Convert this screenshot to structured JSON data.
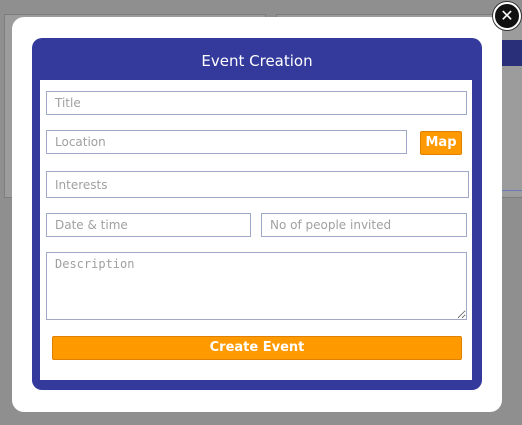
{
  "modal": {
    "close_icon": "close-icon",
    "close_glyph": "✕"
  },
  "event_form": {
    "title": "Event Creation",
    "fields": {
      "title_placeholder": "Title",
      "location_placeholder": "Location",
      "interests_placeholder": "Interests",
      "date_placeholder": "Date & time",
      "people_placeholder": "No of people invited",
      "description_placeholder": "Description"
    },
    "map_button_label": "Map",
    "create_button_label": "Create Event"
  },
  "colors": {
    "panel": "#333a9c",
    "accent": "#ff9900",
    "overlay": "#8f8f8f"
  }
}
